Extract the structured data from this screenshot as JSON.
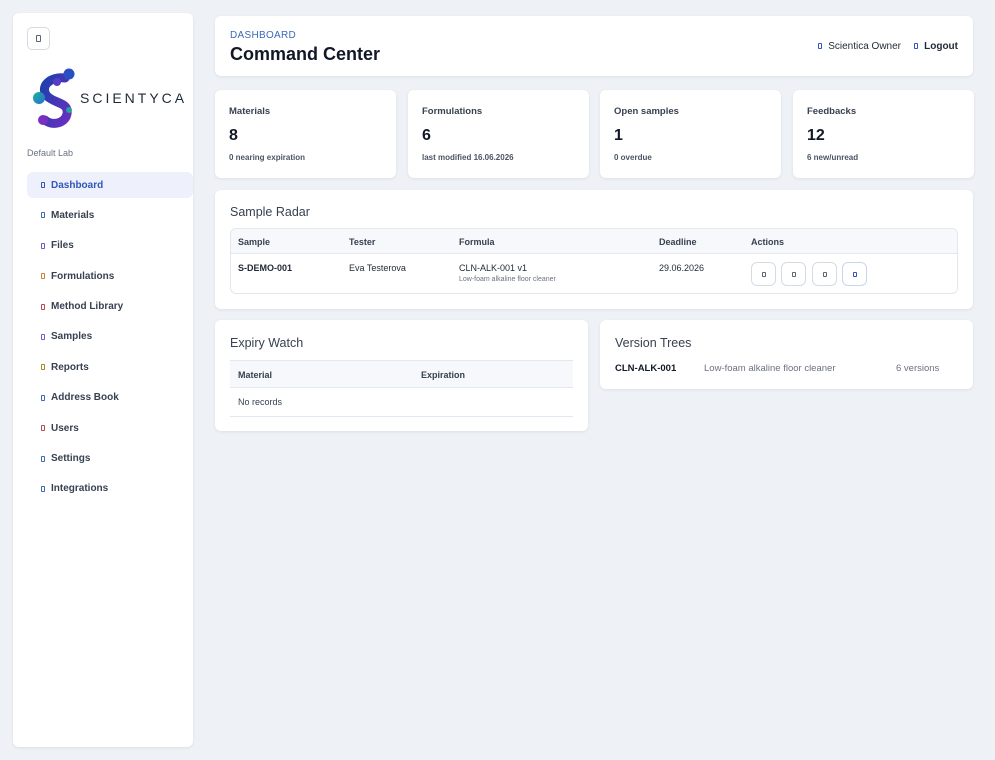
{
  "sidebar": {
    "toggle_icon": "menu-icon",
    "brand": "SCIENTYCA",
    "lab_name": "Default Lab",
    "items": [
      {
        "label": "Dashboard",
        "icon": "dashboard-icon",
        "color": "#2f56b8",
        "active": true
      },
      {
        "label": "Materials",
        "icon": "flask-icon",
        "color": "#3b6ab7"
      },
      {
        "label": "Files",
        "icon": "file-icon",
        "color": "#6d5bd0"
      },
      {
        "label": "Formulations",
        "icon": "beaker-icon",
        "color": "#c7842b"
      },
      {
        "label": "Method Library",
        "icon": "book-icon",
        "color": "#b64a4a"
      },
      {
        "label": "Samples",
        "icon": "vial-icon",
        "color": "#6d5bd0"
      },
      {
        "label": "Reports",
        "icon": "report-icon",
        "color": "#a58a1a"
      },
      {
        "label": "Address Book",
        "icon": "address-book-icon",
        "color": "#3b6ab7"
      },
      {
        "label": "Users",
        "icon": "users-icon",
        "color": "#b64a4a"
      },
      {
        "label": "Settings",
        "icon": "gear-icon",
        "color": "#3b6ab7"
      },
      {
        "label": "Integrations",
        "icon": "plug-icon",
        "color": "#3b6ab7"
      }
    ]
  },
  "header": {
    "eyebrow": "DASHBOARD",
    "title": "Command Center",
    "user_label": "Scientica Owner",
    "logout_label": "Logout"
  },
  "stats": [
    {
      "label": "Materials",
      "value": "8",
      "sub": "0 nearing expiration"
    },
    {
      "label": "Formulations",
      "value": "6",
      "sub": "last modified 16.06.2026"
    },
    {
      "label": "Open samples",
      "value": "1",
      "sub": "0 overdue"
    },
    {
      "label": "Feedbacks",
      "value": "12",
      "sub": "6 new/unread"
    }
  ],
  "radar": {
    "title": "Sample Radar",
    "columns": [
      "Sample",
      "Tester",
      "Formula",
      "Deadline",
      "Actions"
    ],
    "rows": [
      {
        "sample": "S-DEMO-001",
        "tester": "Eva Testerova",
        "formula": "CLN-ALK-001 v1",
        "formula_desc": "Low-foam alkaline floor cleaner",
        "deadline": "29.06.2026"
      }
    ],
    "action_icons": [
      "view-icon",
      "edit-icon",
      "copy-icon",
      "feedback-icon"
    ]
  },
  "expiry": {
    "title": "Expiry Watch",
    "columns": [
      "Material",
      "Expiration"
    ],
    "empty_text": "No records"
  },
  "versions": {
    "title": "Version Trees",
    "rows": [
      {
        "code": "CLN-ALK-001",
        "desc": "Low-foam alkaline floor cleaner",
        "count": "6 versions"
      }
    ]
  },
  "colors": {
    "accent": "#2f56b8",
    "background": "#eef2f7",
    "card": "#ffffff"
  }
}
